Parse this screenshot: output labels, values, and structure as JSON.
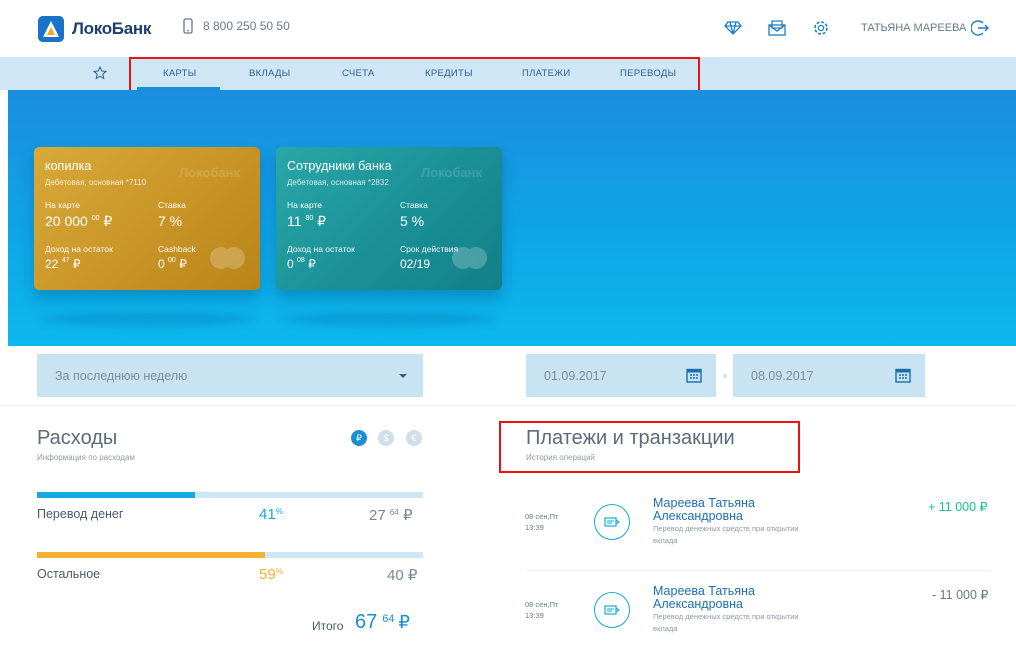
{
  "header": {
    "logo_text": "ЛокоБанк",
    "phone": "8 800 250 50 50",
    "user_name": "ТАТЬЯНА МАРЕЕВА"
  },
  "nav": {
    "items": [
      "КАРТЫ",
      "ВКЛАДЫ",
      "СЧЕТА",
      "КРЕДИТЫ",
      "ПЛАТЕЖИ",
      "ПЕРЕВОДЫ"
    ],
    "active": "КАРТЫ"
  },
  "cards": [
    {
      "name": "копилка",
      "subtitle": "Дебетовая, основная *7110",
      "watermark": "Локобанк",
      "balance_label": "На карте",
      "balance_main": "20 000",
      "balance_cents": "00",
      "rate_label": "Ставка",
      "rate": "7 %",
      "income_label": "Доход на остаток",
      "income_main": "22",
      "income_cents": "47",
      "extra_label": "Cashback",
      "extra_main": "0",
      "extra_cents": "00",
      "currency": "₽",
      "color": "#c99527"
    },
    {
      "name": "Сотрудники банка",
      "subtitle": "Дебетовая, основная *2832",
      "watermark": "Локобанк",
      "balance_label": "На карте",
      "balance_main": "11",
      "balance_cents": "80",
      "rate_label": "Ставка",
      "rate": "5 %",
      "income_label": "Доход на остаток",
      "income_main": "0",
      "income_cents": "08",
      "extra_label": "Срок действия",
      "extra_value": "02/19",
      "currency": "₽",
      "color": "#1a9096"
    }
  ],
  "filters": {
    "period": "За последнюю неделю",
    "date_from": "01.09.2017",
    "date_to": "08.09.2017"
  },
  "expenses": {
    "title": "Расходы",
    "subtitle": "Информация по расходам",
    "currencies": [
      "₽",
      "$",
      "€"
    ],
    "items": [
      {
        "label": "Перевод денег",
        "pct": "41",
        "pct_sign": "%",
        "amount_main": "27",
        "amount_cents": "64",
        "currency": "₽",
        "fraction": 0.41,
        "color": "#14a9e0"
      },
      {
        "label": "Остальное",
        "pct": "59",
        "pct_sign": "%",
        "amount_main": "40",
        "currency": "₽",
        "fraction": 0.59,
        "color": "#f2b233"
      }
    ],
    "total_label": "Итого",
    "total_main": "67",
    "total_cents": "64",
    "total_currency": "₽"
  },
  "transactions": {
    "title": "Платежи и транзакции",
    "subtitle": "История операций",
    "items": [
      {
        "date": "08 сен,Пт",
        "time": "13:39",
        "name_line1": "Мареева Татьяна",
        "name_line2": "Александровна",
        "desc": "Перевод денежных средств при открытии вклада",
        "amount": "+ 11 000 ₽",
        "color": "#19c28a"
      },
      {
        "date": "08 сен,Пт",
        "time": "13:39",
        "name_line1": "Мареева Татьяна",
        "name_line2": "Александровна",
        "desc": "Перевод денежных средств при открытии вклада",
        "amount": "- 11 000 ₽",
        "color": "#6a7a8a"
      }
    ]
  }
}
